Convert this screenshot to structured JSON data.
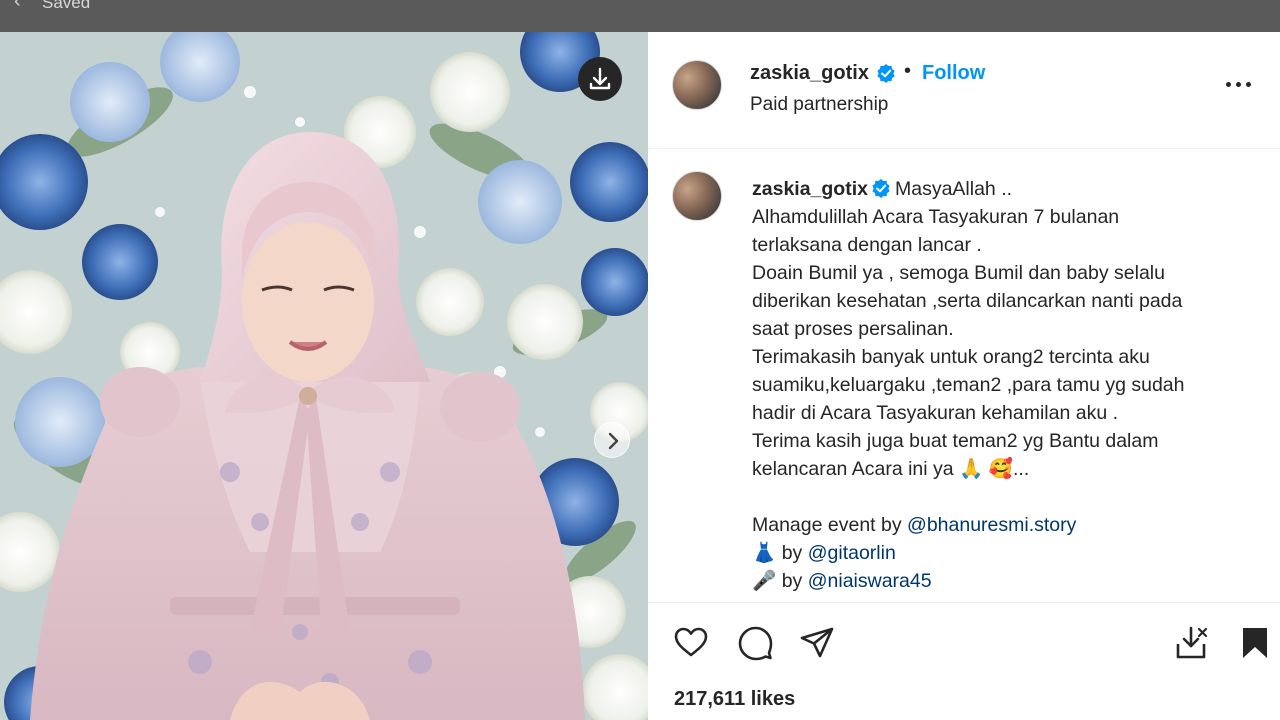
{
  "topbar": {
    "back_icon": "chevron-left-icon",
    "label": "Saved"
  },
  "media": {
    "download_icon": "download-icon",
    "next_icon": "chevron-right-icon"
  },
  "post_header": {
    "username": "zaskia_gotix",
    "verified": true,
    "separator": "•",
    "follow_label": "Follow",
    "subtitle": "Paid partnership",
    "more_icon": "more-horizontal-icon"
  },
  "caption": {
    "username": "zaskia_gotix",
    "lines": [
      "MasyaAllah ..",
      "Alhamdulillah Acara Tasyakuran 7 bulanan",
      "terlaksana dengan lancar .",
      "Doain Bumil ya , semoga Bumil dan baby selalu",
      "diberikan kesehatan ,serta dilancarkan nanti pada",
      "saat proses persalinan.",
      "Terimakasih banyak untuk orang2 tercinta aku",
      "suamiku,keluargaku ,teman2 ,para tamu yg sudah",
      "hadir di Acara Tasyakuran kehamilan aku .",
      "Terima kasih juga buat teman2 yg Bantu dalam",
      "kelancaran Acara ini ya 🙏 🥰..."
    ],
    "credits": [
      {
        "prefix": "Manage event by ",
        "mention": "@bhanuresmi.story"
      },
      {
        "prefix": "👗 by ",
        "mention": "@gitaorlin"
      },
      {
        "prefix": "🎤 by ",
        "mention": "@niaiswara45"
      }
    ]
  },
  "actions": {
    "like_icon": "heart-icon",
    "comment_icon": "comment-icon",
    "share_icon": "share-icon",
    "save_download_icon": "save-download-icon",
    "bookmark_icon": "bookmark-icon"
  },
  "likes_text": "217,611 likes",
  "colors": {
    "link": "#0095f6",
    "verified": "#0095f6",
    "mention": "#00376b",
    "text": "#262626"
  }
}
